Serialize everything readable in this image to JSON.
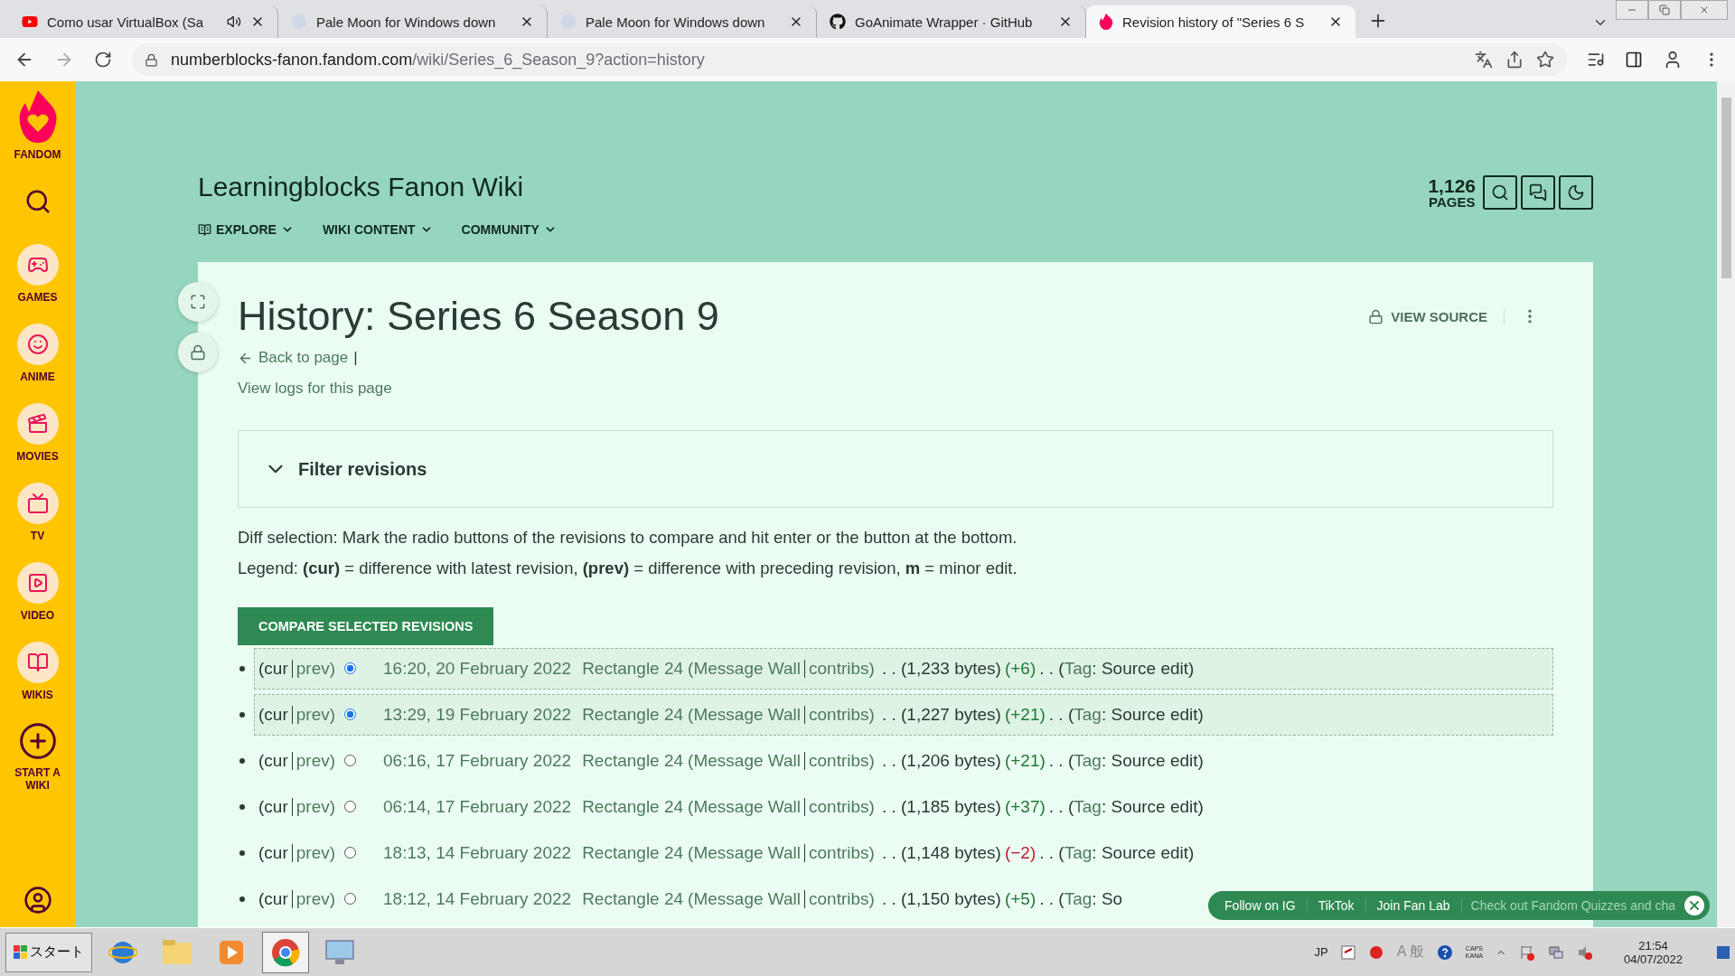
{
  "browser": {
    "tabs": [
      {
        "title": "Como usar VirtualBox (Sa",
        "audio": true,
        "selected": false
      },
      {
        "title": "Pale Moon for Windows down",
        "audio": false,
        "selected": false
      },
      {
        "title": "Pale Moon for Windows down",
        "audio": false,
        "selected": false
      },
      {
        "title": "GoAnimate Wrapper · GitHub",
        "audio": false,
        "selected": false
      },
      {
        "title": "Revision history of \"Series 6 S",
        "audio": false,
        "selected": true
      }
    ],
    "url_host": "numberblocks-fanon.fandom.com",
    "url_path": "/wiki/Series_6_Season_9?action=history"
  },
  "sidebar": {
    "logo": "FANDOM",
    "items": [
      {
        "label": "GAMES"
      },
      {
        "label": "ANIME"
      },
      {
        "label": "MOVIES"
      },
      {
        "label": "TV"
      },
      {
        "label": "VIDEO"
      },
      {
        "label": "WIKIS"
      },
      {
        "label": "START A WIKI"
      }
    ]
  },
  "wiki": {
    "name": "Learningblocks Fanon Wiki",
    "nav": [
      "EXPLORE",
      "WIKI CONTENT",
      "COMMUNITY"
    ],
    "page_count": "1,126",
    "page_count_label": "PAGES"
  },
  "page": {
    "title": "History: Series 6 Season 9",
    "back_link": "Back to page",
    "separator": "|",
    "logs_link": "View logs for this page",
    "view_source": "VIEW SOURCE",
    "filter": "Filter revisions",
    "diff_help": "Diff selection: Mark the radio buttons of the revisions to compare and hit enter or the button at the bottom.",
    "legend": "Legend: **(cur)** = difference with latest revision, **(prev)** = difference with preceding revision, **m** = minor edit.",
    "compare_button": "COMPARE SELECTED REVISIONS",
    "revisions": [
      {
        "cur": "(cur",
        "prev": "prev)",
        "selected": true,
        "date": "16:20, 20 February 2022",
        "user": "Rectangle 24",
        "talk": "(Message Wall",
        "contribs": "contribs)",
        "size": ". . (1,233 bytes)",
        "change": "(+6)",
        "kind": "positive",
        "tag_prefix": ". . (",
        "tag": "Tag",
        "tag_value": ": Source edit)"
      },
      {
        "cur": "(cur",
        "prev": "prev)",
        "selected": true,
        "date": "13:29, 19 February 2022",
        "user": "Rectangle 24",
        "talk": "(Message Wall",
        "contribs": "contribs)",
        "size": ". . (1,227 bytes)",
        "change": "(+21)",
        "kind": "positive",
        "tag_prefix": ". . (",
        "tag": "Tag",
        "tag_value": ": Source edit)"
      },
      {
        "cur": "(cur",
        "prev": "prev)",
        "selected": false,
        "date": "06:16, 17 February 2022",
        "user": "Rectangle 24",
        "talk": "(Message Wall",
        "contribs": "contribs)",
        "size": ". . (1,206 bytes)",
        "change": "(+21)",
        "kind": "positive",
        "tag_prefix": ". . (",
        "tag": "Tag",
        "tag_value": ": Source edit)"
      },
      {
        "cur": "(cur",
        "prev": "prev)",
        "selected": false,
        "date": "06:14, 17 February 2022",
        "user": "Rectangle 24",
        "talk": "(Message Wall",
        "contribs": "contribs)",
        "size": ". . (1,185 bytes)",
        "change": "(+37)",
        "kind": "positive",
        "tag_prefix": ". . (",
        "tag": "Tag",
        "tag_value": ": Source edit)"
      },
      {
        "cur": "(cur",
        "prev": "prev)",
        "selected": false,
        "date": "18:13, 14 February 2022",
        "user": "Rectangle 24",
        "talk": "(Message Wall",
        "contribs": "contribs)",
        "size": ". . (1,148 bytes)",
        "change": "(−2)",
        "kind": "negative",
        "tag_prefix": ". . (",
        "tag": "Tag",
        "tag_value": ": Source edit)"
      },
      {
        "cur": "(cur",
        "prev": "prev)",
        "selected": false,
        "date": "18:12, 14 February 2022",
        "user": "Rectangle 24",
        "talk": "(Message Wall",
        "contribs": "contribs)",
        "size": ". . (1,150 bytes)",
        "change": "(+5)",
        "kind": "positive",
        "tag_prefix": ". . (",
        "tag": "Tag",
        "tag_value": ": So"
      }
    ]
  },
  "social_bar": {
    "links": [
      "Follow on IG",
      "TikTok",
      "Join Fan Lab"
    ],
    "promo": "Check out Fandom Quizzes and cha"
  },
  "taskbar": {
    "start": "スタート",
    "lang": "JP",
    "ime": "A 般",
    "caps": "CAPS",
    "kana": "KANA",
    "time": "21:54",
    "date": "04/07/2022"
  }
}
